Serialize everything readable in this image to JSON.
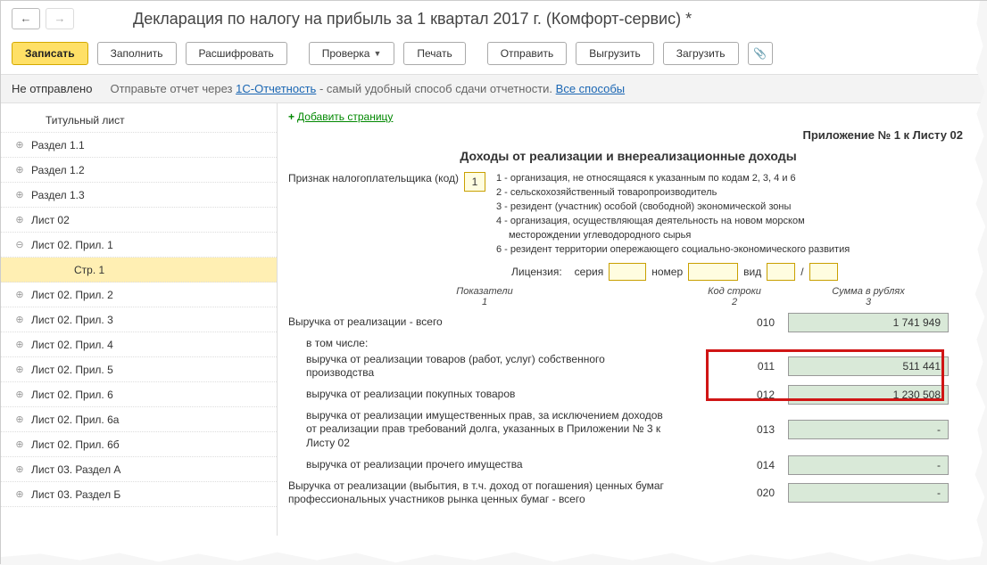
{
  "header": {
    "title": "Декларация по налогу на прибыль за 1 квартал 2017 г. (Комфорт-сервис) *"
  },
  "toolbar": {
    "save": "Записать",
    "fill": "Заполнить",
    "decrypt": "Расшифровать",
    "check": "Проверка",
    "print": "Печать",
    "send": "Отправить",
    "export": "Выгрузить",
    "import": "Загрузить"
  },
  "status": {
    "left": "Не отправлено",
    "right_pre": "Отправьте отчет через ",
    "link1": "1С-Отчетность",
    "right_mid": " - самый удобный способ сдачи отчетности. ",
    "link2": "Все способы"
  },
  "tree": {
    "items": [
      {
        "label": "Титульный лист",
        "indent": 1,
        "toggle": ""
      },
      {
        "label": "Раздел 1.1",
        "indent": 0,
        "toggle": "⊕"
      },
      {
        "label": "Раздел 1.2",
        "indent": 0,
        "toggle": "⊕"
      },
      {
        "label": "Раздел 1.3",
        "indent": 0,
        "toggle": "⊕"
      },
      {
        "label": "Лист 02",
        "indent": 0,
        "toggle": "⊕"
      },
      {
        "label": "Лист 02. Прил. 1",
        "indent": 0,
        "toggle": "⊖"
      },
      {
        "label": "Стр. 1",
        "indent": 2,
        "toggle": "",
        "selected": true
      },
      {
        "label": "Лист 02. Прил. 2",
        "indent": 0,
        "toggle": "⊕"
      },
      {
        "label": "Лист 02. Прил. 3",
        "indent": 0,
        "toggle": "⊕"
      },
      {
        "label": "Лист 02. Прил. 4",
        "indent": 0,
        "toggle": "⊕"
      },
      {
        "label": "Лист 02. Прил. 5",
        "indent": 0,
        "toggle": "⊕"
      },
      {
        "label": "Лист 02. Прил. 6",
        "indent": 0,
        "toggle": "⊕"
      },
      {
        "label": "Лист 02. Прил. 6а",
        "indent": 0,
        "toggle": "⊕"
      },
      {
        "label": "Лист 02. Прил. 6б",
        "indent": 0,
        "toggle": "⊕"
      },
      {
        "label": "Лист 03. Раздел А",
        "indent": 0,
        "toggle": "⊕"
      },
      {
        "label": "Лист 03. Раздел Б",
        "indent": 0,
        "toggle": "⊕"
      }
    ]
  },
  "content": {
    "add_page": "Добавить страницу",
    "appendix": "Приложение № 1 к Листу 02",
    "title": "Доходы от реализации и внереализационные доходы",
    "taxpayer_label": "Признак налогоплательщика (код)",
    "taxpayer_code": "1",
    "notes": {
      "n1": "1 - организация, не относящаяся к указанным по кодам 2, 3, 4 и 6",
      "n2": "2 - сельскохозяйственный товаропроизводитель",
      "n3": "3 - резидент (участник) особой (свободной) экономической зоны",
      "n4a": "4 - организация, осуществляющая деятельность на новом морском",
      "n4b": "месторождении углеводородного сырья",
      "n6": "6 - резидент территории опережающего социально-экономического развития"
    },
    "license": {
      "label": "Лицензия:",
      "series": "серия",
      "number": "номер",
      "type": "вид",
      "slash": "/"
    },
    "cols": {
      "c1a": "Показатели",
      "c1b": "1",
      "c2a": "Код строки",
      "c2b": "2",
      "c3a": "Сумма в рублях",
      "c3b": "3"
    },
    "rows": {
      "r010": {
        "desc": "Выручка от реализации - всего",
        "code": "010",
        "value": "1 741 949"
      },
      "sub": "в том числе:",
      "r011": {
        "desc": "выручка от реализации товаров (работ, услуг) собственного производства",
        "code": "011",
        "value": "511 441"
      },
      "r012": {
        "desc": "выручка от реализации покупных товаров",
        "code": "012",
        "value": "1 230 508"
      },
      "r013": {
        "desc": "выручка от реализации имущественных прав, за исключением доходов от реализации прав требований долга, указанных в Приложении № 3 к Листу 02",
        "code": "013",
        "value": ""
      },
      "r014": {
        "desc": "выручка от реализации прочего имущества",
        "code": "014",
        "value": ""
      },
      "r020": {
        "desc": "Выручка от реализации (выбытия, в т.ч. доход от погашения) ценных бумаг профессиональных участников рынка ценных бумаг - всего",
        "code": "020",
        "value": ""
      }
    }
  }
}
